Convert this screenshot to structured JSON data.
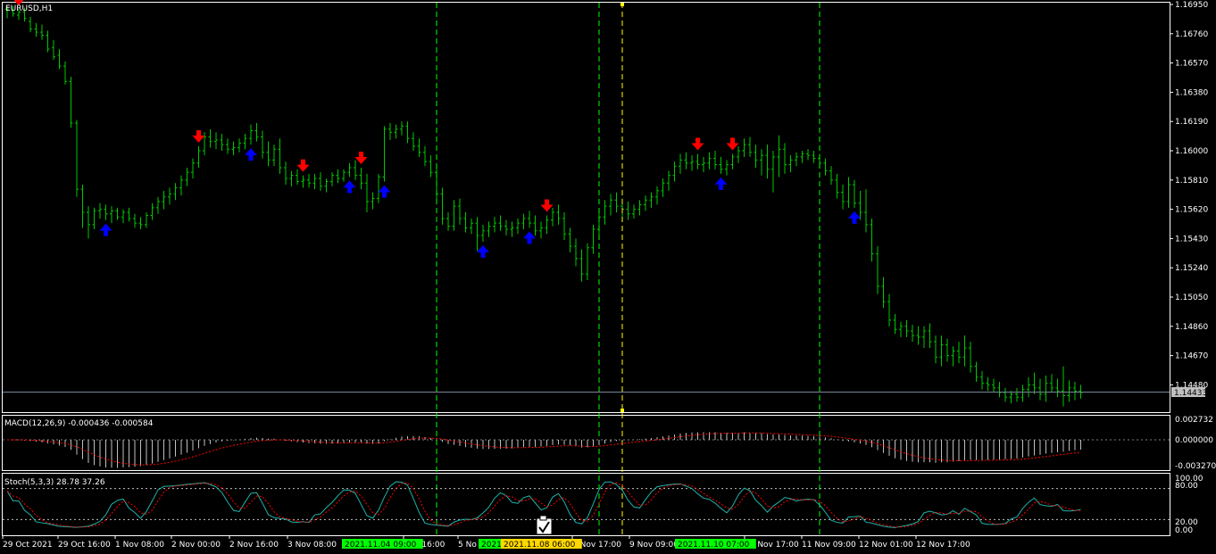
{
  "main": {
    "title": "EURUSD,H1",
    "price_axis": [
      "1.16950",
      "1.16760",
      "1.16570",
      "1.16380",
      "1.16190",
      "1.16000",
      "1.15810",
      "1.15620",
      "1.15430",
      "1.15240",
      "1.15050",
      "1.14860",
      "1.14670",
      "1.14480"
    ],
    "current_price": "1.14433",
    "ohlc": [
      [
        1.1692,
        1.1694,
        1.1686,
        1.1692
      ],
      [
        1.1691,
        1.1694,
        1.1687,
        1.1689
      ],
      [
        1.1688,
        1.1692,
        1.1685,
        1.169
      ],
      [
        1.169,
        1.1693,
        1.1684,
        1.1686
      ],
      [
        1.1684,
        1.1687,
        1.1677,
        1.1679
      ],
      [
        1.1679,
        1.1683,
        1.1674,
        1.1677
      ],
      [
        1.1677,
        1.1682,
        1.1672,
        1.1675
      ],
      [
        1.1675,
        1.1678,
        1.1664,
        1.1666
      ],
      [
        1.1667,
        1.1672,
        1.1659,
        1.1661
      ],
      [
        1.1662,
        1.1666,
        1.1653,
        1.1655
      ],
      [
        1.1655,
        1.1658,
        1.1643,
        1.1645
      ],
      [
        1.1645,
        1.1648,
        1.1615,
        1.1618
      ],
      [
        1.1618,
        1.162,
        1.157,
        1.1575
      ],
      [
        1.1575,
        1.1578,
        1.155,
        1.156
      ],
      [
        1.156,
        1.1564,
        1.1543,
        1.1552
      ],
      [
        1.1552,
        1.1563,
        1.1549,
        1.1561
      ],
      [
        1.1561,
        1.1566,
        1.1556,
        1.1562
      ],
      [
        1.1562,
        1.1565,
        1.1555,
        1.1559
      ],
      [
        1.1559,
        1.1564,
        1.1553,
        1.1561
      ],
      [
        1.1561,
        1.1563,
        1.1555,
        1.1557
      ],
      [
        1.1557,
        1.1562,
        1.1553,
        1.156
      ],
      [
        1.156,
        1.1563,
        1.1554,
        1.1556
      ],
      [
        1.1556,
        1.1559,
        1.155,
        1.1553
      ],
      [
        1.1553,
        1.1557,
        1.1549,
        1.1552
      ],
      [
        1.1552,
        1.156,
        1.155,
        1.1558
      ],
      [
        1.1558,
        1.1566,
        1.1555,
        1.1563
      ],
      [
        1.1563,
        1.157,
        1.1559,
        1.1567
      ],
      [
        1.1567,
        1.1574,
        1.1562,
        1.157
      ],
      [
        1.157,
        1.1576,
        1.1565,
        1.1572
      ],
      [
        1.1572,
        1.1579,
        1.1568,
        1.1576
      ],
      [
        1.1576,
        1.1584,
        1.1571,
        1.1581
      ],
      [
        1.1581,
        1.1589,
        1.1577,
        1.1586
      ],
      [
        1.1586,
        1.1595,
        1.1582,
        1.1592
      ],
      [
        1.1592,
        1.1603,
        1.1589,
        1.16
      ],
      [
        1.16,
        1.1612,
        1.1597,
        1.1609
      ],
      [
        1.1609,
        1.1614,
        1.1602,
        1.1606
      ],
      [
        1.1606,
        1.1612,
        1.1601,
        1.1607
      ],
      [
        1.1607,
        1.1611,
        1.16,
        1.1604
      ],
      [
        1.1604,
        1.1608,
        1.1598,
        1.1601
      ],
      [
        1.1601,
        1.1606,
        1.1597,
        1.1602
      ],
      [
        1.1602,
        1.1608,
        1.1599,
        1.1605
      ],
      [
        1.1605,
        1.1611,
        1.1601,
        1.1608
      ],
      [
        1.1608,
        1.1617,
        1.1604,
        1.1613
      ],
      [
        1.1613,
        1.1618,
        1.1606,
        1.1609
      ],
      [
        1.1609,
        1.1613,
        1.1595,
        1.1599
      ],
      [
        1.1599,
        1.1606,
        1.159,
        1.1594
      ],
      [
        1.1594,
        1.1604,
        1.159,
        1.1601
      ],
      [
        1.1601,
        1.1608,
        1.1585,
        1.1589
      ],
      [
        1.1589,
        1.1593,
        1.1578,
        1.1582
      ],
      [
        1.1582,
        1.1587,
        1.1577,
        1.1584
      ],
      [
        1.1584,
        1.1588,
        1.1578,
        1.158
      ],
      [
        1.158,
        1.1584,
        1.1576,
        1.1581
      ],
      [
        1.1581,
        1.1585,
        1.1576,
        1.1579
      ],
      [
        1.1579,
        1.1585,
        1.1575,
        1.1582
      ],
      [
        1.1582,
        1.1586,
        1.1574,
        1.1577
      ],
      [
        1.1577,
        1.1582,
        1.1573,
        1.158
      ],
      [
        1.158,
        1.1586,
        1.1577,
        1.1584
      ],
      [
        1.1584,
        1.1588,
        1.1579,
        1.1582
      ],
      [
        1.1582,
        1.1588,
        1.158,
        1.1586
      ],
      [
        1.1586,
        1.1592,
        1.1583,
        1.1589
      ],
      [
        1.1589,
        1.1594,
        1.1581,
        1.1584
      ],
      [
        1.1584,
        1.1589,
        1.1575,
        1.1579
      ],
      [
        1.1579,
        1.1585,
        1.156,
        1.1567
      ],
      [
        1.1567,
        1.1573,
        1.1562,
        1.1569
      ],
      [
        1.1569,
        1.1585,
        1.1566,
        1.1583
      ],
      [
        1.1583,
        1.1616,
        1.158,
        1.1614
      ],
      [
        1.1614,
        1.1618,
        1.1607,
        1.1612
      ],
      [
        1.1612,
        1.1617,
        1.1608,
        1.1614
      ],
      [
        1.1614,
        1.1619,
        1.161,
        1.1616
      ],
      [
        1.1616,
        1.1619,
        1.1605,
        1.1608
      ],
      [
        1.1608,
        1.1612,
        1.16,
        1.1603
      ],
      [
        1.1603,
        1.1608,
        1.1596,
        1.1599
      ],
      [
        1.1599,
        1.1603,
        1.159,
        1.1593
      ],
      [
        1.1593,
        1.1597,
        1.1583,
        1.1586
      ],
      [
        1.1586,
        1.159,
        1.1568,
        1.1572
      ],
      [
        1.1572,
        1.1576,
        1.1552,
        1.1556
      ],
      [
        1.1556,
        1.156,
        1.1548,
        1.1551
      ],
      [
        1.1551,
        1.1568,
        1.1548,
        1.1564
      ],
      [
        1.1564,
        1.1569,
        1.1552,
        1.1556
      ],
      [
        1.1556,
        1.156,
        1.1547,
        1.155
      ],
      [
        1.155,
        1.1556,
        1.1546,
        1.1553
      ],
      [
        1.1553,
        1.1557,
        1.1535,
        1.1545
      ],
      [
        1.1545,
        1.1552,
        1.1541,
        1.1548
      ],
      [
        1.1548,
        1.1554,
        1.1544,
        1.1551
      ],
      [
        1.1551,
        1.1557,
        1.1547,
        1.1553
      ],
      [
        1.1553,
        1.1558,
        1.1548,
        1.1551
      ],
      [
        1.1551,
        1.1555,
        1.1545,
        1.1549
      ],
      [
        1.1549,
        1.1554,
        1.1544,
        1.155
      ],
      [
        1.155,
        1.1556,
        1.1546,
        1.1553
      ],
      [
        1.1553,
        1.1559,
        1.1549,
        1.1556
      ],
      [
        1.1556,
        1.1561,
        1.155,
        1.1553
      ],
      [
        1.1553,
        1.1558,
        1.1545,
        1.1548
      ],
      [
        1.1548,
        1.1554,
        1.1543,
        1.155
      ],
      [
        1.155,
        1.1558,
        1.1546,
        1.1555
      ],
      [
        1.1555,
        1.1563,
        1.1551,
        1.156
      ],
      [
        1.156,
        1.1565,
        1.1552,
        1.1556
      ],
      [
        1.1556,
        1.156,
        1.1542,
        1.1546
      ],
      [
        1.1546,
        1.155,
        1.1534,
        1.1538
      ],
      [
        1.1538,
        1.1543,
        1.1525,
        1.153
      ],
      [
        1.153,
        1.1536,
        1.1515,
        1.152
      ],
      [
        1.152,
        1.154,
        1.1516,
        1.1537
      ],
      [
        1.1537,
        1.1552,
        1.1533,
        1.1549
      ],
      [
        1.1549,
        1.156,
        1.1545,
        1.1557
      ],
      [
        1.1557,
        1.1568,
        1.1552,
        1.1564
      ],
      [
        1.1564,
        1.1572,
        1.1558,
        1.1568
      ],
      [
        1.1568,
        1.1573,
        1.156,
        1.1564
      ],
      [
        1.1564,
        1.1569,
        1.1557,
        1.1562
      ],
      [
        1.1562,
        1.1567,
        1.1555,
        1.1559
      ],
      [
        1.1559,
        1.1565,
        1.1556,
        1.1562
      ],
      [
        1.1562,
        1.1568,
        1.1558,
        1.1565
      ],
      [
        1.1565,
        1.1571,
        1.1561,
        1.1568
      ],
      [
        1.1568,
        1.1573,
        1.1563,
        1.157
      ],
      [
        1.157,
        1.1577,
        1.1565,
        1.1574
      ],
      [
        1.1574,
        1.1582,
        1.157,
        1.1579
      ],
      [
        1.1579,
        1.1587,
        1.1574,
        1.1584
      ],
      [
        1.1584,
        1.1593,
        1.158,
        1.159
      ],
      [
        1.159,
        1.1598,
        1.1585,
        1.1594
      ],
      [
        1.1594,
        1.1599,
        1.1588,
        1.1592
      ],
      [
        1.1592,
        1.1597,
        1.1587,
        1.1593
      ],
      [
        1.1593,
        1.1598,
        1.1588,
        1.1591
      ],
      [
        1.1591,
        1.1596,
        1.1586,
        1.1592
      ],
      [
        1.1592,
        1.1599,
        1.1588,
        1.1595
      ],
      [
        1.1595,
        1.16,
        1.1588,
        1.1591
      ],
      [
        1.1591,
        1.1596,
        1.1585,
        1.1588
      ],
      [
        1.1588,
        1.1594,
        1.1584,
        1.1591
      ],
      [
        1.1591,
        1.1598,
        1.1588,
        1.1596
      ],
      [
        1.1596,
        1.1603,
        1.1592,
        1.16
      ],
      [
        1.16,
        1.1608,
        1.1596,
        1.1604
      ],
      [
        1.1604,
        1.1609,
        1.1596,
        1.1599
      ],
      [
        1.1599,
        1.1604,
        1.1589,
        1.1594
      ],
      [
        1.1594,
        1.1601,
        1.1584,
        1.1597
      ],
      [
        1.1597,
        1.1604,
        1.1582,
        1.1588
      ],
      [
        1.1588,
        1.16,
        1.1573,
        1.1596
      ],
      [
        1.1596,
        1.161,
        1.1583,
        1.1601
      ],
      [
        1.1601,
        1.1605,
        1.1585,
        1.1591
      ],
      [
        1.1591,
        1.1597,
        1.1586,
        1.1594
      ],
      [
        1.1594,
        1.1599,
        1.159,
        1.1596
      ],
      [
        1.1596,
        1.16,
        1.1592,
        1.1598
      ],
      [
        1.1598,
        1.1601,
        1.1594,
        1.1597
      ],
      [
        1.1597,
        1.16,
        1.1592,
        1.1595
      ],
      [
        1.1595,
        1.1598,
        1.1589,
        1.1592
      ],
      [
        1.1592,
        1.1595,
        1.1584,
        1.1587
      ],
      [
        1.1587,
        1.159,
        1.1578,
        1.1581
      ],
      [
        1.1581,
        1.1585,
        1.1569,
        1.1573
      ],
      [
        1.1573,
        1.1578,
        1.1562,
        1.1567
      ],
      [
        1.1567,
        1.1583,
        1.1563,
        1.1578
      ],
      [
        1.1578,
        1.1581,
        1.1563,
        1.1566
      ],
      [
        1.1566,
        1.1574,
        1.1555,
        1.156
      ],
      [
        1.156,
        1.1575,
        1.1547,
        1.1552
      ],
      [
        1.1552,
        1.1556,
        1.1528,
        1.1533
      ],
      [
        1.1533,
        1.1538,
        1.1507,
        1.1512
      ],
      [
        1.1512,
        1.1518,
        1.1498,
        1.1502
      ],
      [
        1.1502,
        1.1507,
        1.1486,
        1.149
      ],
      [
        1.149,
        1.1494,
        1.1481,
        1.1484
      ],
      [
        1.1484,
        1.1489,
        1.1479,
        1.1486
      ],
      [
        1.1486,
        1.149,
        1.1479,
        1.1483
      ],
      [
        1.1483,
        1.1487,
        1.1476,
        1.148
      ],
      [
        1.148,
        1.1486,
        1.1474,
        1.1479
      ],
      [
        1.1479,
        1.1486,
        1.1472,
        1.1483
      ],
      [
        1.1483,
        1.1488,
        1.1472,
        1.1476
      ],
      [
        1.1476,
        1.148,
        1.1462,
        1.1466
      ],
      [
        1.1466,
        1.148,
        1.146,
        1.1474
      ],
      [
        1.1474,
        1.1478,
        1.1463,
        1.1467
      ],
      [
        1.1467,
        1.1473,
        1.146,
        1.147
      ],
      [
        1.147,
        1.1476,
        1.1462,
        1.1466
      ],
      [
        1.1466,
        1.148,
        1.146,
        1.1472
      ],
      [
        1.1472,
        1.1476,
        1.1456,
        1.146
      ],
      [
        1.146,
        1.1463,
        1.145,
        1.1453
      ],
      [
        1.1453,
        1.1457,
        1.1445,
        1.1449
      ],
      [
        1.1449,
        1.1453,
        1.1444,
        1.1448
      ],
      [
        1.1448,
        1.1452,
        1.1443,
        1.1446
      ],
      [
        1.1446,
        1.145,
        1.144,
        1.1443
      ],
      [
        1.1443,
        1.1446,
        1.1437,
        1.144
      ],
      [
        1.144,
        1.1444,
        1.1436,
        1.1442
      ],
      [
        1.1442,
        1.1446,
        1.1437,
        1.144
      ],
      [
        1.144,
        1.1448,
        1.1437,
        1.1445
      ],
      [
        1.1445,
        1.1453,
        1.144,
        1.1448
      ],
      [
        1.1448,
        1.1456,
        1.1442,
        1.1446
      ],
      [
        1.1446,
        1.1452,
        1.1438,
        1.1442
      ],
      [
        1.1442,
        1.1454,
        1.1437,
        1.1449
      ],
      [
        1.1449,
        1.1455,
        1.1443,
        1.1446
      ],
      [
        1.1446,
        1.1452,
        1.144,
        1.1444
      ],
      [
        1.1444,
        1.146,
        1.1434,
        1.1441
      ],
      [
        1.1441,
        1.1451,
        1.1437,
        1.1446
      ],
      [
        1.1446,
        1.145,
        1.1438,
        1.1444
      ],
      [
        1.1444,
        1.1448,
        1.1439,
        1.1443
      ]
    ],
    "buy_arrows": [
      17,
      42,
      59,
      65,
      82,
      90,
      123,
      146
    ],
    "sell_arrows": [
      2,
      33,
      51,
      61,
      93,
      119,
      125
    ]
  },
  "vlines": [
    {
      "bar": 74,
      "color": "#00ff00",
      "label": "2021.11.04 09:00",
      "label_bg": "#00ff00"
    },
    {
      "bar": 102,
      "color": "#00ff00",
      "label": "2021",
      "label_bg": "#00ff00"
    },
    {
      "bar": 106,
      "color": "#ffff00",
      "label": "2021.11.08 06:00",
      "label_bg": "#ffd700"
    },
    {
      "bar": 140,
      "color": "#00ff00",
      "label": "2021.11.10 07:00",
      "label_bg": "#00ff00"
    }
  ],
  "macd": {
    "title": "MACD(12,26,9) -0.000436 -0.000584",
    "axis": [
      "0.002732",
      "0.000000",
      "-0.003270"
    ]
  },
  "stoch": {
    "title": "Stoch(5,3,3) 28.78 37.26",
    "axis": [
      "100.00",
      "80.00",
      "20.00",
      "0.00"
    ]
  },
  "time_axis": [
    "29 Oct 2021",
    "29 Oct 16:00",
    "1 Nov 08:00",
    "2 Nov 00:00",
    "2 Nov 16:00",
    "3 Nov 08:00",
    "Nov 16:00",
    "5 No",
    "8 Nov 17:00",
    "9 Nov 09:00",
    "10 Nov 17:00",
    "11 Nov 09:00",
    "12 Nov 01:00",
    "12 Nov 17:00"
  ],
  "colors": {
    "bull": "#00c800",
    "bear": "#00c800",
    "buy_arrow": "#0000ff",
    "sell_arrow": "#ff0000",
    "bid_line": "#778899",
    "macd_hist": "#c0c0c0",
    "macd_signal": "#ff0000",
    "stoch_main": "#20b2aa",
    "stoch_signal": "#ff0000"
  }
}
